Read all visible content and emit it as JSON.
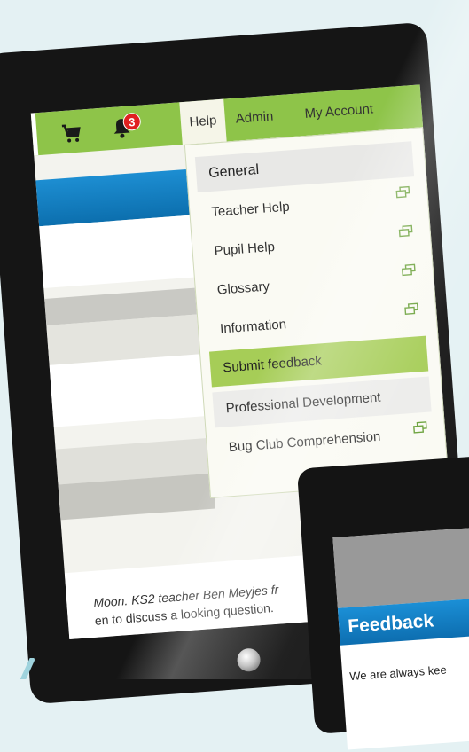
{
  "topbar": {
    "notification_count": "3",
    "nav": {
      "help": "Help",
      "admin": "Admin",
      "account": "My Account"
    }
  },
  "help_menu": {
    "items": [
      {
        "label": "General",
        "external": false
      },
      {
        "label": "Teacher Help",
        "external": true
      },
      {
        "label": "Pupil Help",
        "external": true
      },
      {
        "label": "Glossary",
        "external": true
      },
      {
        "label": "Information",
        "external": true
      },
      {
        "label": "Submit feedback",
        "external": false
      },
      {
        "label": "Professional Development",
        "external": false
      },
      {
        "label": "Bug Club Comprehension",
        "external": true
      }
    ]
  },
  "news": {
    "line1": "Moon. KS2 teacher Ben Meyjes fr",
    "line2": "en to discuss a looking question."
  },
  "phone": {
    "title": "Feedback",
    "text": "We are always kee"
  },
  "colors": {
    "topbar_green": "#8ec449",
    "highlight_green": "#a6cd57",
    "header_blue": "#1d8ed2",
    "badge_red": "#e02121"
  }
}
